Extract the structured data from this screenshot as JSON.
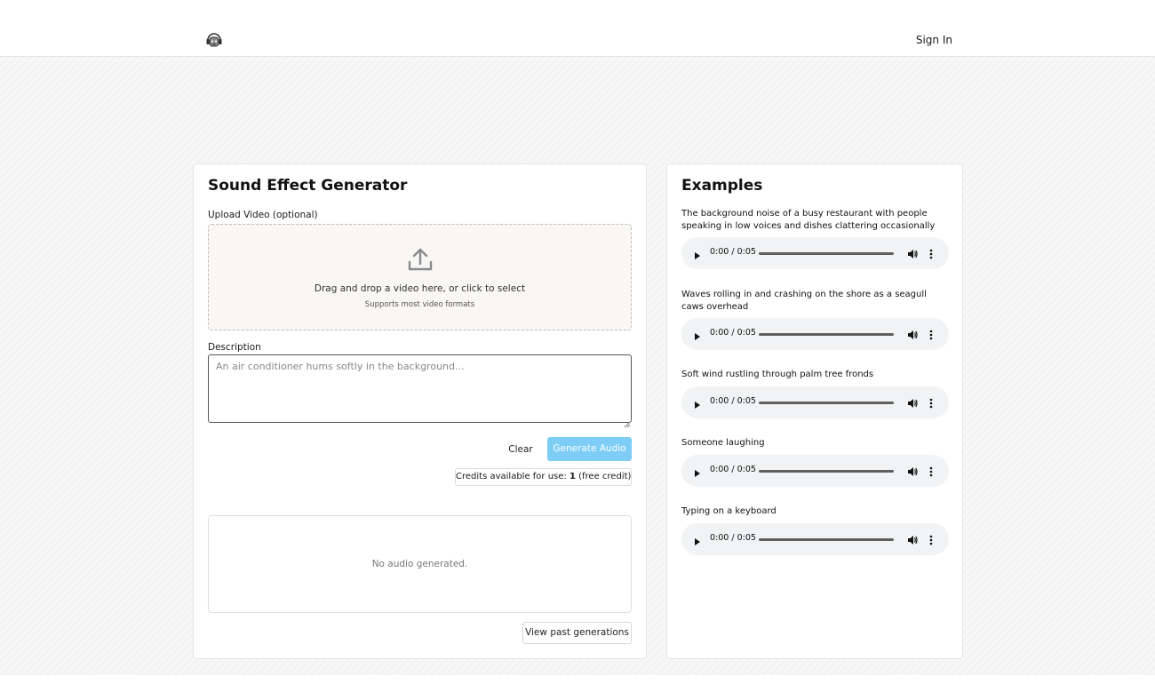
{
  "header": {
    "logo_icon": "robot-headphones-icon",
    "sign_in_label": "Sign In"
  },
  "generator": {
    "title": "Sound Effect Generator",
    "upload_label": "Upload Video (optional)",
    "dropzone": {
      "icon": "upload-icon",
      "main_text": "Drag and drop a video here, or click to select",
      "sub_text": "Supports most video formats"
    },
    "description_label": "Description",
    "description_placeholder": "An air conditioner hums softly in the background...",
    "description_value": "",
    "clear_label": "Clear",
    "generate_label": "Generate Audio",
    "generate_color": "#7dcdf7",
    "credits": {
      "prefix": "Credits available for use: ",
      "count": "1",
      "suffix": " (free credit)"
    },
    "result_empty_text": "No audio generated.",
    "past_generations_label": "View past generations"
  },
  "examples": {
    "title": "Examples",
    "items": [
      {
        "text": "The background noise of a busy restaurant with people speaking in low voices and dishes clattering occasionally",
        "time": "0:00 / 0:05"
      },
      {
        "text": "Waves rolling in and crashing on the shore as a seagull caws overhead",
        "time": "0:00 / 0:05"
      },
      {
        "text": "Soft wind rustling through palm tree fronds",
        "time": "0:00 / 0:05"
      },
      {
        "text": "Someone laughing",
        "time": "0:00 / 0:05"
      },
      {
        "text": "Typing on a keyboard",
        "time": "0:00 / 0:05"
      }
    ]
  }
}
